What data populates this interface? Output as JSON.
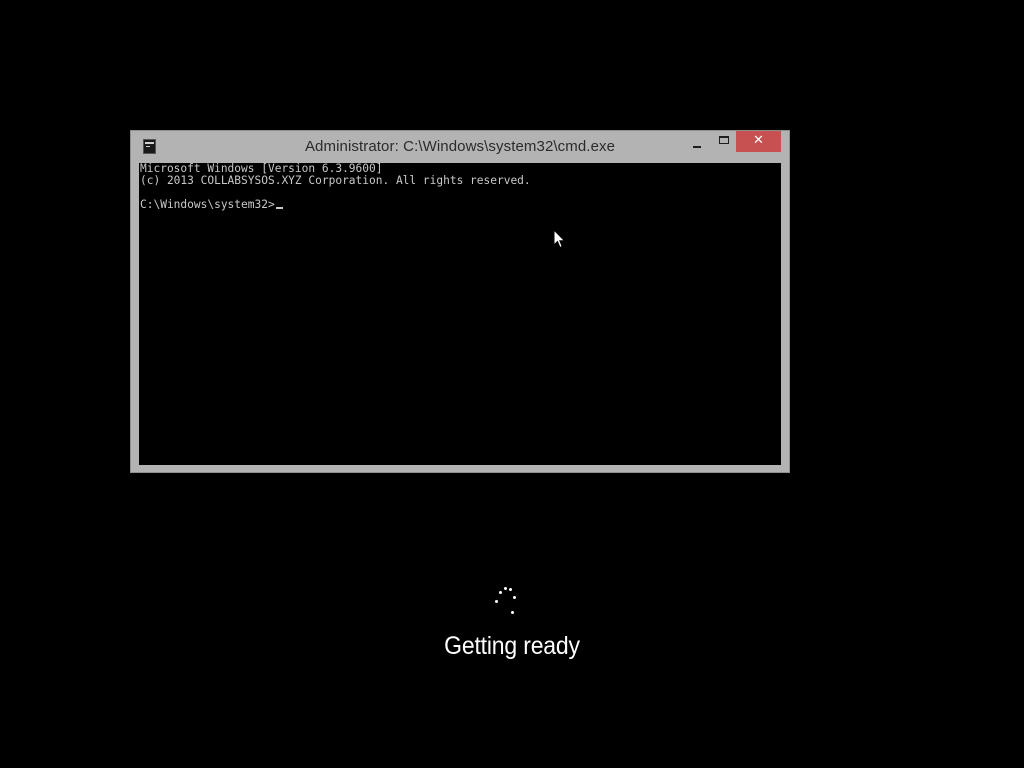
{
  "cmd_window": {
    "title": "Administrator: C:\\Windows\\system32\\cmd.exe",
    "close_label": "✕",
    "console_lines": [
      "Microsoft Windows [Version 6.3.9600]",
      "(c) 2013 COLLABSYSOS.XYZ Corporation. All rights reserved.",
      "",
      "C:\\Windows\\system32>"
    ],
    "icons": {
      "app": "console-app-icon",
      "minimize": "minimize-icon",
      "maximize": "maximize-icon",
      "close": "close-icon"
    }
  },
  "setup": {
    "status_text": "Getting ready",
    "spinner_icon": "loading-spinner-icon"
  },
  "colors": {
    "background": "#000000",
    "close_button": "#c75050",
    "window_frame": "#b3b3b3",
    "console_text": "#c8c8c8"
  }
}
